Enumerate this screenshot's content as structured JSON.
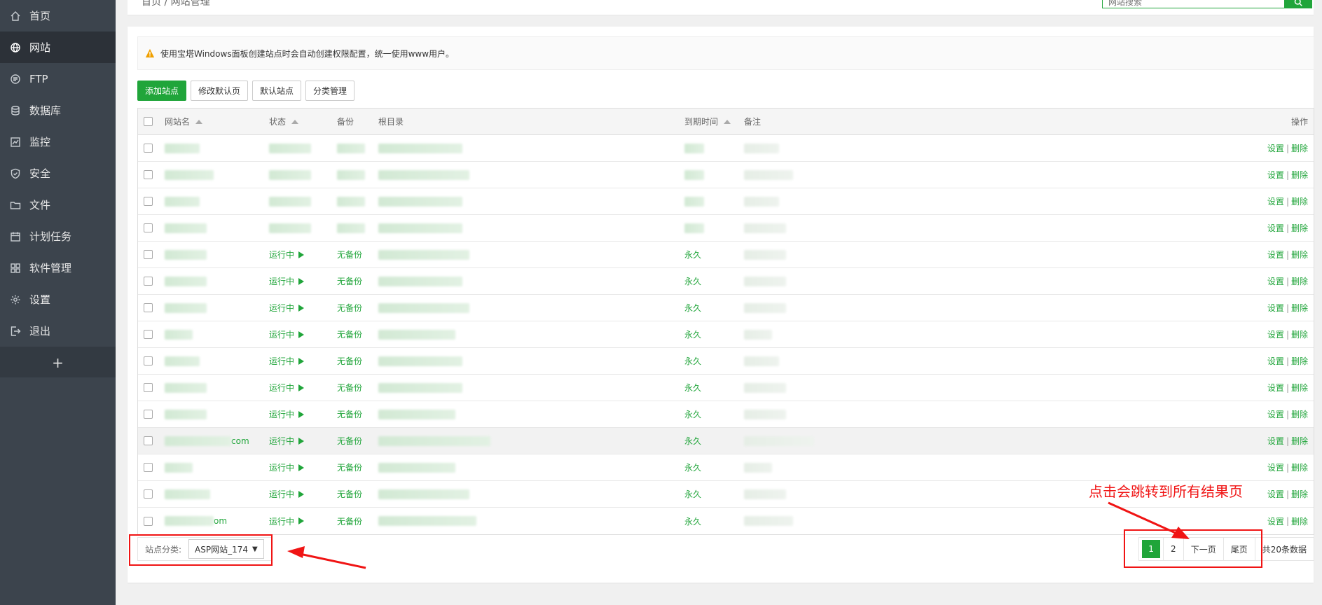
{
  "sidebar": {
    "items": [
      {
        "label": "首页",
        "icon": "home-icon",
        "active": false
      },
      {
        "label": "网站",
        "icon": "globe-icon",
        "active": true
      },
      {
        "label": "FTP",
        "icon": "ftp-icon",
        "active": false
      },
      {
        "label": "数据库",
        "icon": "database-icon",
        "active": false
      },
      {
        "label": "监控",
        "icon": "monitor-icon",
        "active": false
      },
      {
        "label": "安全",
        "icon": "shield-icon",
        "active": false
      },
      {
        "label": "文件",
        "icon": "folder-icon",
        "active": false
      },
      {
        "label": "计划任务",
        "icon": "calendar-icon",
        "active": false
      },
      {
        "label": "软件管理",
        "icon": "apps-icon",
        "active": false
      },
      {
        "label": "设置",
        "icon": "gear-icon",
        "active": false
      },
      {
        "label": "退出",
        "icon": "logout-icon",
        "active": false
      }
    ],
    "add_label": "+"
  },
  "breadcrumb": "首页 / 网站管理",
  "search": {
    "placeholder": "网站搜索"
  },
  "notice": "使用宝塔Windows面板创建站点时会自动创建权限配置，统一使用www用户。",
  "toolbar": {
    "add_site": "添加站点",
    "modify_default_page": "修改默认页",
    "default_site": "默认站点",
    "category_manage": "分类管理"
  },
  "table": {
    "headers": {
      "name": "网站名",
      "status": "状态",
      "backup": "备份",
      "root": "根目录",
      "expire": "到期时间",
      "note": "备注",
      "ops": "操作"
    },
    "rows": [
      {
        "name": "",
        "status": "",
        "backup": "",
        "expire": "",
        "highlight": false
      },
      {
        "name": "",
        "status": "",
        "backup": "",
        "expire": "",
        "highlight": false
      },
      {
        "name": "",
        "status": "",
        "backup": "",
        "expire": "",
        "highlight": false
      },
      {
        "name": "",
        "status": "",
        "backup": "",
        "expire": "",
        "highlight": false
      },
      {
        "name": "",
        "status": "运行中",
        "backup": "无备份",
        "expire": "永久",
        "highlight": false
      },
      {
        "name": "",
        "status": "运行中",
        "backup": "无备份",
        "expire": "永久",
        "highlight": false
      },
      {
        "name": "",
        "status": "运行中",
        "backup": "无备份",
        "expire": "永久",
        "highlight": false
      },
      {
        "name": "",
        "status": "运行中",
        "backup": "无备份",
        "expire": "永久",
        "highlight": false
      },
      {
        "name": "",
        "status": "运行中",
        "backup": "无备份",
        "expire": "永久",
        "highlight": false
      },
      {
        "name": "",
        "status": "运行中",
        "backup": "无备份",
        "expire": "永久",
        "highlight": false
      },
      {
        "name": "",
        "status": "运行中",
        "backup": "无备份",
        "expire": "永久",
        "highlight": false
      },
      {
        "name": "com",
        "status": "运行中",
        "backup": "无备份",
        "expire": "永久",
        "highlight": true
      },
      {
        "name": "",
        "status": "运行中",
        "backup": "无备份",
        "expire": "永久",
        "highlight": false
      },
      {
        "name": "",
        "status": "运行中",
        "backup": "无备份",
        "expire": "永久",
        "highlight": false
      },
      {
        "name": "om",
        "status": "运行中",
        "backup": "无备份",
        "expire": "永久",
        "highlight": false
      }
    ],
    "op_set": "设置",
    "op_sep": "|",
    "op_delete": "删除"
  },
  "footer": {
    "category_label": "站点分类:",
    "category_value": "ASP网站_174",
    "pages": [
      "1",
      "2"
    ],
    "next": "下一页",
    "last": "尾页",
    "total": "共20条数据"
  },
  "annotation": {
    "text": "点击会跳转到所有结果页",
    "color": "#f01414"
  },
  "colors": {
    "accent": "#20a53a",
    "sidebar_bg": "#3c444d",
    "annotation": "#f01414"
  }
}
